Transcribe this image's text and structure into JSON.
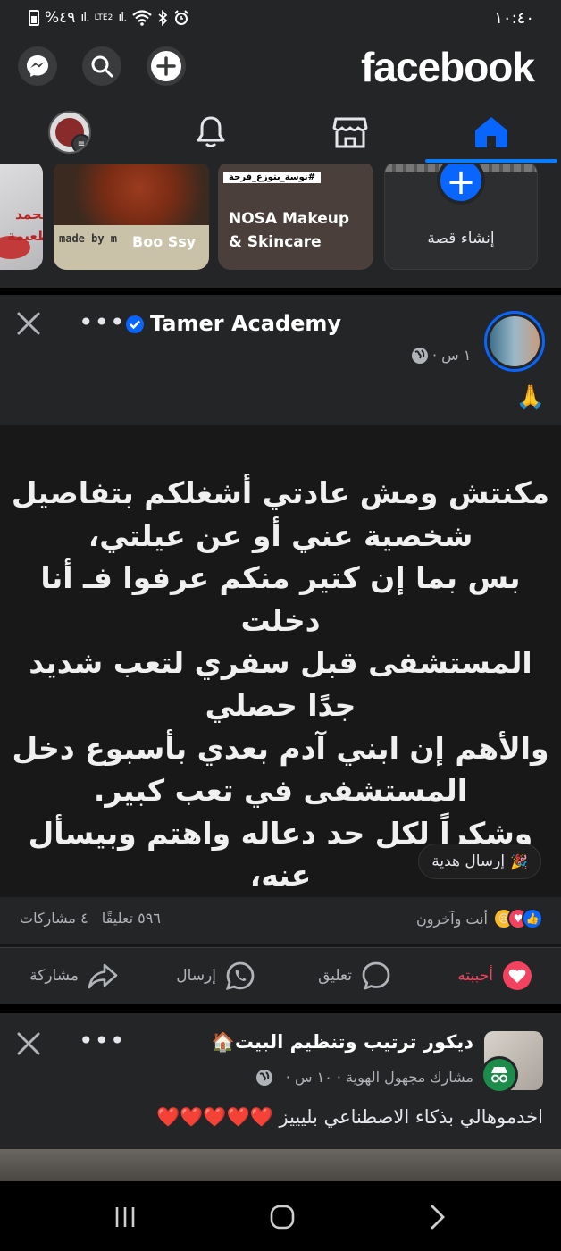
{
  "status_bar": {
    "time": "١٠:٤٠",
    "battery": "%٤٩",
    "network": "LTE2"
  },
  "header": {
    "logo": "facebook",
    "icons": [
      "messenger-icon",
      "search-icon",
      "add-icon"
    ],
    "tabs": [
      "profile-menu",
      "notifications",
      "marketplace",
      "home"
    ],
    "active_tab": "home",
    "accent": "#0866ff"
  },
  "stories": [
    {
      "label": "محمد طعيمة"
    },
    {
      "label": "Boo Ssy",
      "caption": "made by m"
    },
    {
      "label": "NOSA Makeup & Skincare",
      "hashtag": "#نوسة_بتوزع_فرحة"
    },
    {
      "label": "إنشاء قصة"
    }
  ],
  "post1": {
    "page_name": "Tamer Academy",
    "time": "١ س ·",
    "emoji_line": "🙏",
    "body": "مكنتش ومش عادتي أشغلكم بتفاصيل\nشخصية عني أو عن عيلتي،\nبس بما إن كتير منكم عرفوا فـ أنا دخلت\nالمستشفى قبل سفري لتعب شديد جدًا حصلي\nوالأهم إن ابني آدم بعدي بأسبوع دخل\nالمستشفى في تعب كبير.\nوشكراً لكل حد دعاله واهتم وبيسأل عنه،\nوربنا ما يكتب أي ألم ولا وجع لأي حد منكم\nأو من ولادكم 🤲",
    "gift_label": "إرسال هدية",
    "reactions_label": "أنت وآخرون",
    "comments_count": "٥٩٦ تعليقًا",
    "shares_count": "٤ مشاركات",
    "actions": {
      "like": "أحببته",
      "comment": "تعليق",
      "send": "إرسال",
      "share": "مشاركة"
    },
    "like_color": "#f3425f"
  },
  "post2": {
    "group_name": "ديكور ترتيب وتنظيم البيت🏠",
    "meta": "مشارك مجهول الهوية · ١٠ س ·",
    "text": "اخدموهالي بذكاء الاصطناعي بليييز ❤️❤️❤️❤️❤️"
  }
}
